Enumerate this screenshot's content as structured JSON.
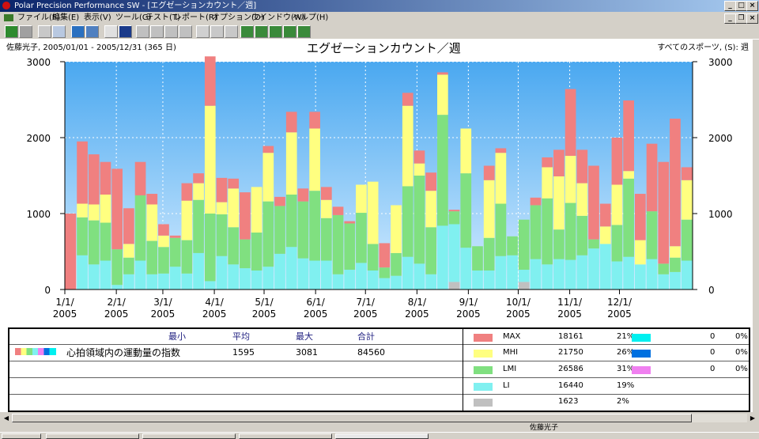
{
  "window": {
    "title": "Polar Precision Performance SW - [エグゼーションカウント／週]"
  },
  "menu": [
    "ファイル(F)",
    "編集(E)",
    "表示(V)",
    "ツール(G)",
    "テスト(T)",
    "レポート(R)",
    "オプション(O)",
    "ウインドウ(W)",
    "ヘルプ(H)"
  ],
  "header": {
    "left": "佐藤光子, 2005/01/01 - 2005/12/31 (365 日)",
    "title": "エグゼーションカウント／週",
    "right": "すべてのスポーツ, (S): 週"
  },
  "chart_data": {
    "type": "bar",
    "stacked": true,
    "ylim": [
      0,
      3000
    ],
    "yticks": [
      "0",
      "1000",
      "2000",
      "3000"
    ],
    "xtick_labels": [
      [
        "1/1/",
        "2005"
      ],
      [
        "2/1/",
        "2005"
      ],
      [
        "3/1/",
        "2005"
      ],
      [
        "4/1/",
        "2005"
      ],
      [
        "5/1/",
        "2005"
      ],
      [
        "6/1/",
        "2005"
      ],
      [
        "7/1/",
        "2005"
      ],
      [
        "8/1/",
        "2005"
      ],
      [
        "9/1/",
        "2005"
      ],
      [
        "10/1/",
        "2005"
      ],
      [
        "11/1/",
        "2005"
      ],
      [
        "12/1/",
        "2005"
      ]
    ],
    "series_colors": {
      "grey": "#c0c0c0",
      "LI": "#80f0f0",
      "LMI": "#80e080",
      "MHI": "#ffff80",
      "MAX": "#f08080"
    },
    "bars": [
      [
        0,
        0,
        0,
        0,
        1000
      ],
      [
        0,
        450,
        500,
        180,
        820
      ],
      [
        0,
        330,
        580,
        210,
        660
      ],
      [
        0,
        380,
        500,
        370,
        430
      ],
      [
        0,
        60,
        470,
        0,
        1060
      ],
      [
        0,
        200,
        220,
        180,
        470
      ],
      [
        0,
        380,
        860,
        0,
        440
      ],
      [
        0,
        200,
        440,
        480,
        140
      ],
      [
        0,
        210,
        350,
        150,
        150
      ],
      [
        0,
        300,
        380,
        0,
        30
      ],
      [
        0,
        210,
        440,
        520,
        230
      ],
      [
        0,
        480,
        700,
        220,
        130
      ],
      [
        0,
        110,
        890,
        1420,
        650
      ],
      [
        0,
        440,
        550,
        160,
        320
      ],
      [
        0,
        330,
        490,
        510,
        130
      ],
      [
        0,
        280,
        380,
        0,
        620
      ],
      [
        0,
        250,
        500,
        600,
        0
      ],
      [
        0,
        300,
        860,
        640,
        90
      ],
      [
        0,
        470,
        630,
        0,
        120
      ],
      [
        0,
        560,
        690,
        820,
        270
      ],
      [
        0,
        410,
        750,
        0,
        170
      ],
      [
        0,
        380,
        920,
        820,
        220
      ],
      [
        0,
        380,
        560,
        240,
        170
      ],
      [
        0,
        200,
        780,
        0,
        110
      ],
      [
        0,
        260,
        610,
        0,
        30
      ],
      [
        0,
        350,
        660,
        370,
        0
      ],
      [
        0,
        250,
        350,
        820,
        0
      ],
      [
        0,
        150,
        140,
        0,
        320
      ],
      [
        0,
        180,
        300,
        630,
        0
      ],
      [
        0,
        430,
        930,
        1060,
        170
      ],
      [
        0,
        340,
        1160,
        160,
        170
      ],
      [
        0,
        200,
        620,
        480,
        240
      ],
      [
        0,
        840,
        1460,
        530,
        30
      ],
      [
        100,
        760,
        170,
        0,
        20
      ],
      [
        0,
        550,
        980,
        590,
        0
      ],
      [
        0,
        250,
        320,
        0,
        0
      ],
      [
        0,
        250,
        430,
        760,
        190
      ],
      [
        0,
        440,
        690,
        670,
        60
      ],
      [
        0,
        450,
        250,
        0,
        0
      ],
      [
        100,
        160,
        660,
        0,
        0
      ],
      [
        0,
        400,
        710,
        0,
        100
      ],
      [
        0,
        330,
        870,
        410,
        130
      ],
      [
        0,
        400,
        390,
        700,
        350
      ],
      [
        0,
        390,
        750,
        620,
        880
      ],
      [
        0,
        450,
        520,
        430,
        440
      ],
      [
        0,
        540,
        120,
        0,
        970
      ],
      [
        0,
        600,
        0,
        230,
        300
      ],
      [
        0,
        370,
        480,
        530,
        620
      ],
      [
        0,
        430,
        1030,
        100,
        930
      ],
      [
        0,
        330,
        0,
        320,
        610
      ],
      [
        0,
        400,
        630,
        0,
        890
      ],
      [
        0,
        200,
        140,
        0,
        1340
      ],
      [
        0,
        230,
        190,
        150,
        1680
      ],
      [
        0,
        380,
        540,
        520,
        170
      ]
    ]
  },
  "summary": {
    "col_min": "最小",
    "col_avg": "平均",
    "col_max": "最大",
    "col_total": "合計",
    "row_label": "心拍領域内の運動量の指数",
    "avg": "1595",
    "max": "3081",
    "total": "84560"
  },
  "legend": [
    {
      "color": "#f08080",
      "name": "MAX",
      "value": "18161",
      "pct": "21%"
    },
    {
      "color": "#ffff80",
      "name": "MHI",
      "value": "21750",
      "pct": "26%"
    },
    {
      "color": "#80e080",
      "name": "LMI",
      "value": "26586",
      "pct": "31%"
    },
    {
      "color": "#80f0f0",
      "name": "LI",
      "value": "16440",
      "pct": "19%"
    },
    {
      "color": "#c0c0c0",
      "name": "",
      "value": "1623",
      "pct": "2%"
    }
  ],
  "legend_right": [
    {
      "color": "#00f0f0",
      "value": "0",
      "pct": "0%"
    },
    {
      "color": "#0070e0",
      "value": "0",
      "pct": "0%"
    },
    {
      "color": "#f080f0",
      "value": "0",
      "pct": "0%"
    }
  ],
  "status": {
    "text": "佐藤光子"
  }
}
